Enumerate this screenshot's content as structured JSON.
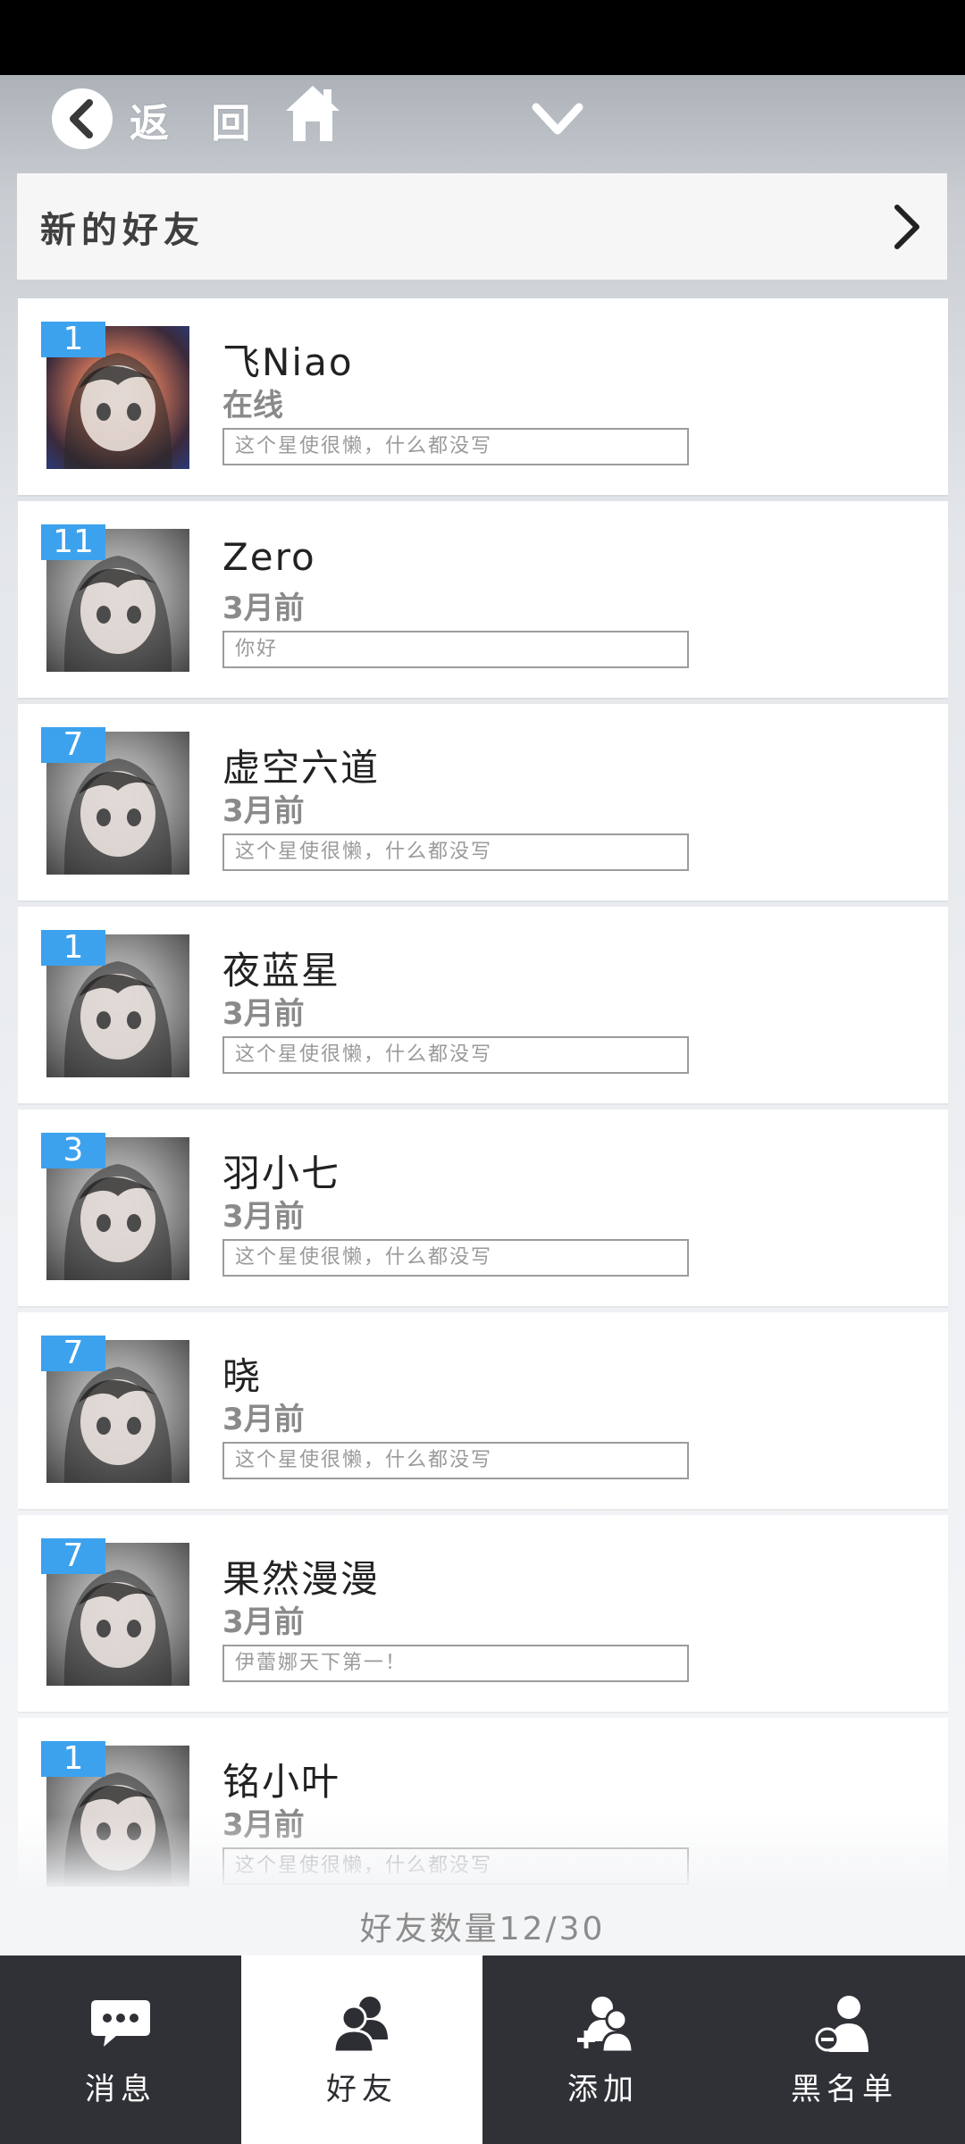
{
  "topnav": {
    "back_label": "返 回"
  },
  "new_friends": {
    "label": "新的好友"
  },
  "friends": [
    {
      "level": "1",
      "name": "飞Niao",
      "status": "在线",
      "signature": "这个星使很懒，什么都没写",
      "avatar": "color"
    },
    {
      "level": "11",
      "name": "Zero",
      "status": "3月前",
      "signature": "你好",
      "avatar": "gray"
    },
    {
      "level": "7",
      "name": "虚空六道",
      "status": "3月前",
      "signature": "这个星使很懒，什么都没写",
      "avatar": "gray"
    },
    {
      "level": "1",
      "name": "夜蓝星",
      "status": "3月前",
      "signature": "这个星使很懒，什么都没写",
      "avatar": "gray"
    },
    {
      "level": "3",
      "name": "羽小七",
      "status": "3月前",
      "signature": "这个星使很懒，什么都没写",
      "avatar": "gray"
    },
    {
      "level": "7",
      "name": "晓",
      "status": "3月前",
      "signature": "这个星使很懒，什么都没写",
      "avatar": "gray"
    },
    {
      "level": "7",
      "name": "果然漫漫",
      "status": "3月前",
      "signature": "伊蕾娜天下第一！",
      "avatar": "gray"
    },
    {
      "level": "1",
      "name": "铭小叶",
      "status": "3月前",
      "signature": "这个星使很懒，什么都没写",
      "avatar": "gray"
    }
  ],
  "friend_count": "好友数量12/30",
  "tabs": [
    {
      "label": "消息",
      "icon": "chat-bubble-icon",
      "active": false
    },
    {
      "label": "好友",
      "icon": "friends-icon",
      "active": true
    },
    {
      "label": "添加",
      "icon": "add-friend-icon",
      "active": false
    },
    {
      "label": "黑名单",
      "icon": "blacklist-icon",
      "active": false
    }
  ],
  "colors": {
    "badge": "#3da2ee",
    "tab_bar": "#303136",
    "active_tab": "#ffffff"
  }
}
